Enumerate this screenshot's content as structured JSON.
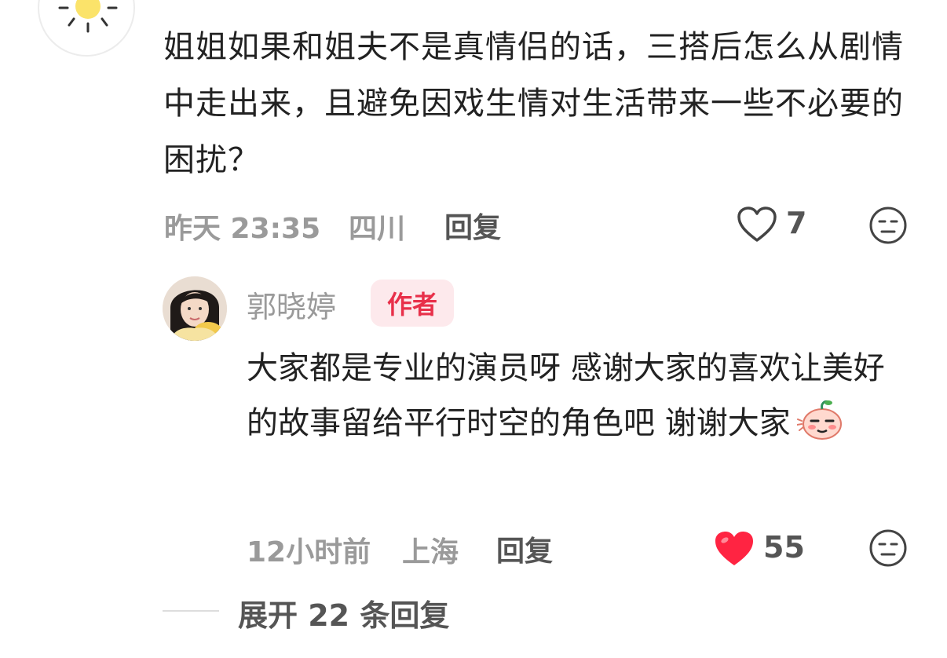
{
  "parent_comment": {
    "avatar": "sun-avatar",
    "text": "姐姐如果和姐夫不是真情侣的话，三搭后怎么从剧情中走出来，且避免因戏生情对生活带来一些不必要的困扰？",
    "time": "昨天 23:35",
    "location": "四川",
    "reply_label": "回复",
    "like_count": "7",
    "liked": false,
    "icons": {
      "like": "heart-outline-icon",
      "dislike": "meh-face-icon"
    }
  },
  "reply": {
    "author": "郭晓婷",
    "badge": "作者",
    "text": "大家都是专业的演员呀 感谢大家的喜欢让美好的故事留给平行时空的角色吧 谢谢大家",
    "emoji": "blushing-peach-emoji",
    "time": "12小时前",
    "location": "上海",
    "reply_label": "回复",
    "like_count": "55",
    "liked": true,
    "icons": {
      "like": "heart-filled-icon",
      "dislike": "meh-face-icon"
    }
  },
  "expand_replies": "展开 22 条回复",
  "colors": {
    "accent_red": "#ff2442",
    "badge_bg": "#fde9ec",
    "badge_text": "#e8304a",
    "meta_gray": "#9a9a9a"
  }
}
